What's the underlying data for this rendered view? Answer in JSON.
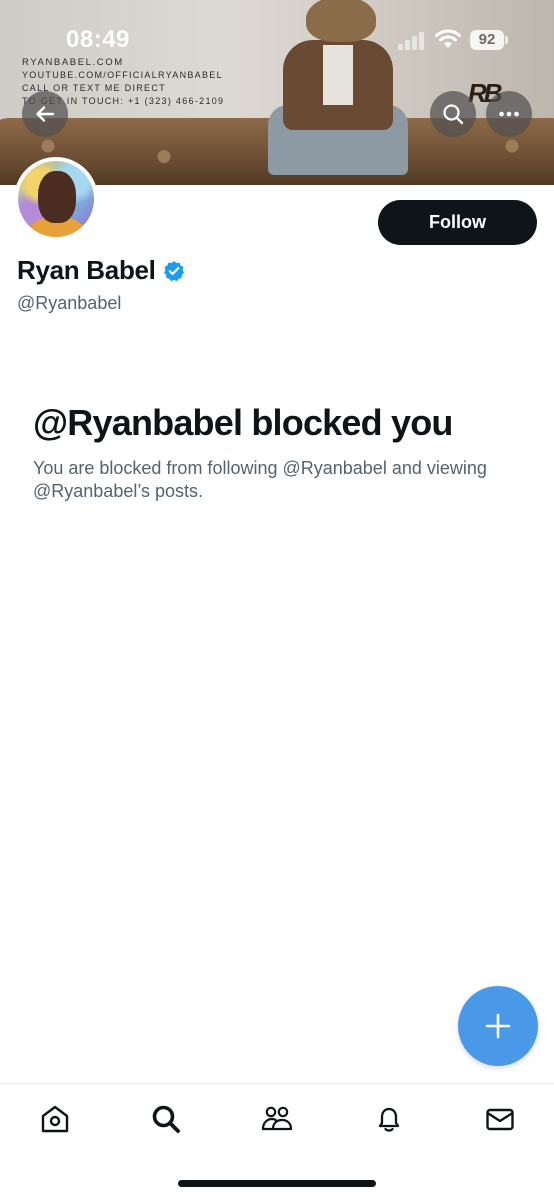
{
  "status_bar": {
    "time": "08:49",
    "battery": "92"
  },
  "banner": {
    "line1": "RYANBABEL.COM",
    "line2": "YOUTUBE.COM/OFFICIALRYANBABEL",
    "line3": "CALL OR TEXT ME DIRECT",
    "line4": "TO GET IN TOUCH: +1 (323) 466-2109",
    "monogram": "RB"
  },
  "profile": {
    "name": "Ryan Babel",
    "handle": "@Ryanbabel",
    "verified": true,
    "follow_label": "Follow"
  },
  "blocked": {
    "title": "@Ryanbabel blocked you",
    "body": "You are blocked from following @Ryanbabel and viewing @Ryanbabel’s posts."
  },
  "tabs": [
    {
      "icon": "home-icon"
    },
    {
      "icon": "search-icon"
    },
    {
      "icon": "communities-icon"
    },
    {
      "icon": "notifications-icon"
    },
    {
      "icon": "messages-icon"
    }
  ],
  "colors": {
    "accent": "#4a99e9",
    "follow_bg": "#0f1419",
    "secondary_text": "#536471",
    "verified": "#1d9bf0"
  }
}
